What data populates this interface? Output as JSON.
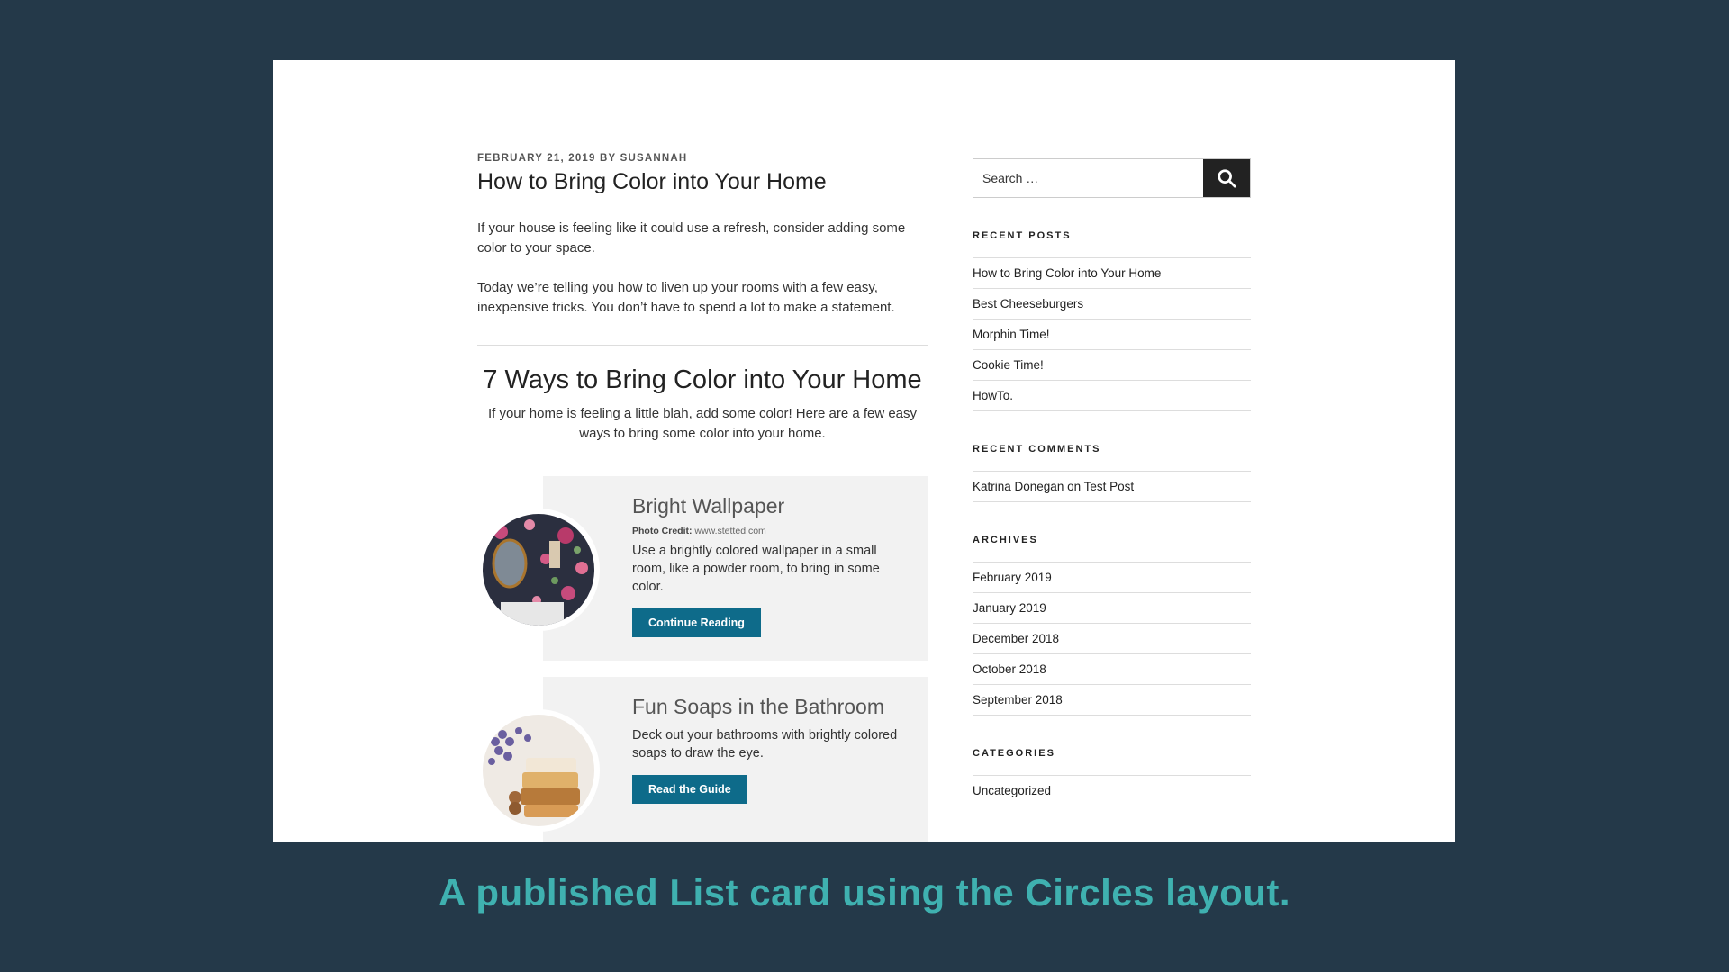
{
  "post": {
    "meta": "FEBRUARY 21, 2019 BY SUSANNAH",
    "title": "How to Bring Color into Your Home",
    "paragraphs": [
      "If your house is feeling like it could use a refresh, consider adding some color to your space.",
      "Today we’re telling you how to liven up your rooms with a few easy, inexpensive tricks. You don’t have to spend a lot to make a statement."
    ]
  },
  "list": {
    "title": "7 Ways to Bring Color into Your Home",
    "intro": "If your home is feeling a little blah, add some color! Here are a few easy ways to bring some color into your home.",
    "items": [
      {
        "title": "Bright Wallpaper",
        "credit_label": "Photo Credit:",
        "credit_value": "www.stetted.com",
        "text": "Use a brightly colored wallpaper in a small room, like a powder room, to bring in some color.",
        "button": "Continue Reading"
      },
      {
        "title": "Fun Soaps in the Bathroom",
        "text": "Deck out your bathrooms with brightly colored soaps to draw the eye.",
        "button": "Read the Guide"
      }
    ]
  },
  "sidebar": {
    "search_placeholder": "Search …",
    "recent_posts": {
      "title": "RECENT POSTS",
      "items": [
        "How to Bring Color into Your Home",
        "Best Cheeseburgers",
        "Morphin Time!",
        "Cookie Time!",
        "HowTo."
      ]
    },
    "recent_comments": {
      "title": "RECENT COMMENTS",
      "items": [
        "Katrina Donegan on Test Post"
      ]
    },
    "archives": {
      "title": "ARCHIVES",
      "items": [
        "February 2019",
        "January 2019",
        "December 2018",
        "October 2018",
        "September 2018"
      ]
    },
    "categories": {
      "title": "CATEGORIES",
      "items": [
        "Uncategorized"
      ]
    }
  },
  "caption": "A published List card using the Circles layout.",
  "colors": {
    "background": "#243949",
    "button": "#0e6b8a",
    "caption": "#3fb1b0"
  },
  "icons": {
    "search": "search-icon"
  }
}
